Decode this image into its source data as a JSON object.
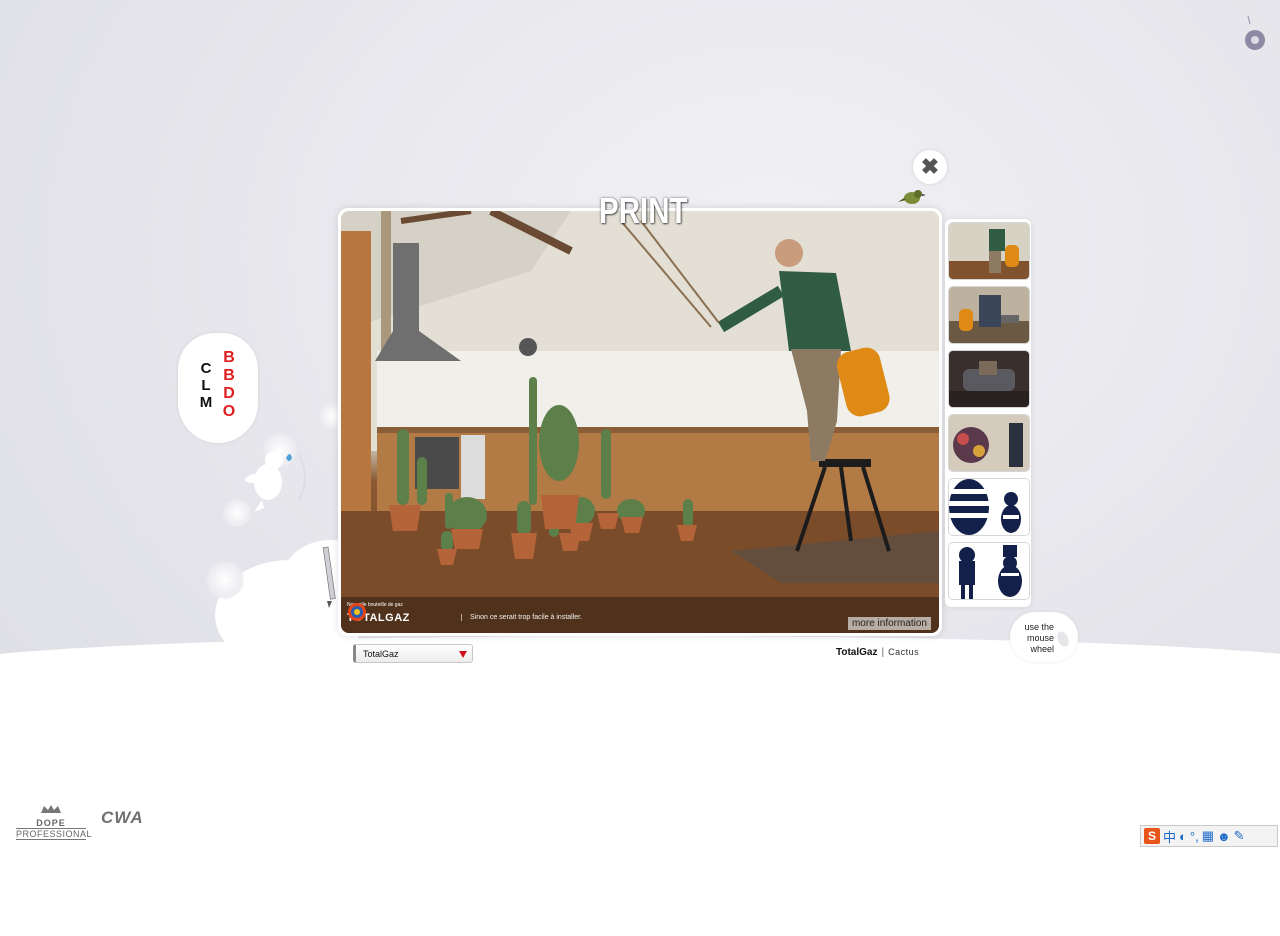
{
  "header": {
    "title": "PRINT"
  },
  "close": {
    "icon": "close-icon",
    "glyph": "✖"
  },
  "agency": {
    "left": [
      "C",
      "L",
      "M"
    ],
    "right": [
      "B",
      "B",
      "D",
      "O"
    ]
  },
  "viewer": {
    "ad": {
      "brand": "TOTALGAZ",
      "brand_small": "Nouvelle bouteille de gaz",
      "tagline": "Sinon ce serait trop facile à installer."
    },
    "more_info": "more information"
  },
  "thumbnails": [
    {
      "name": "thumb-1",
      "selected": true
    },
    {
      "name": "thumb-2"
    },
    {
      "name": "thumb-3"
    },
    {
      "name": "thumb-4"
    },
    {
      "name": "thumb-5"
    },
    {
      "name": "thumb-6"
    }
  ],
  "hint": {
    "text": "use the mouse wheel"
  },
  "campaign_select": {
    "value": "TotalGaz"
  },
  "caption": {
    "client": "TotalGaz",
    "separator": "|",
    "title": "Cactus"
  },
  "footer": {
    "dope_top": "DOPE",
    "dope_bottom": "PROFESSIONAL",
    "cwa": "CWA"
  },
  "ime": {
    "logo": "S",
    "lang": "中",
    "icons": [
      "moon-icon",
      "punctuation-icon",
      "keyboard-icon",
      "user-icon",
      "wrench-icon"
    ]
  },
  "colors": {
    "accent_red": "#e02020",
    "select_arrow": "#d0101a"
  }
}
